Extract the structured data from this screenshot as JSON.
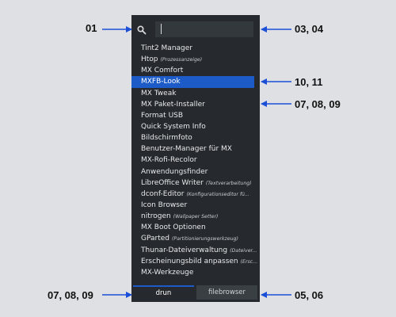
{
  "launcher": {
    "search": {
      "icon": "search-icon",
      "value": ""
    },
    "items": [
      {
        "label": "Tint2 Manager",
        "comment": ""
      },
      {
        "label": "Htop",
        "comment": "(Prozessanzeige)"
      },
      {
        "label": "MX Comfort",
        "comment": ""
      },
      {
        "label": "MXFB-Look",
        "comment": "",
        "selected": true
      },
      {
        "label": "MX Tweak",
        "comment": ""
      },
      {
        "label": "MX Paket-Installer",
        "comment": ""
      },
      {
        "label": "Format USB",
        "comment": ""
      },
      {
        "label": "Quick System Info",
        "comment": ""
      },
      {
        "label": "Bildschirmfoto",
        "comment": ""
      },
      {
        "label": "Benutzer-Manager für MX",
        "comment": ""
      },
      {
        "label": "MX-Rofi-Recolor",
        "comment": ""
      },
      {
        "label": "Anwendungsfinder",
        "comment": ""
      },
      {
        "label": "LibreOffice Writer",
        "comment": "(Textverarbeitung)"
      },
      {
        "label": "dconf-Editor",
        "comment": "(Konfigurationseditor fü..."
      },
      {
        "label": "Icon Browser",
        "comment": ""
      },
      {
        "label": "nitrogen",
        "comment": "(Wallpaper Setter)"
      },
      {
        "label": "MX Boot Optionen",
        "comment": ""
      },
      {
        "label": "GParted",
        "comment": "(Partitionierungswerkzeug)"
      },
      {
        "label": "Thunar-Dateiverwaltung",
        "comment": "(Dateiver..."
      },
      {
        "label": "Erscheinungsbild anpassen",
        "comment": "(Ersc..."
      },
      {
        "label": "MX-Werkzeuge",
        "comment": ""
      }
    ],
    "tabs": [
      {
        "label": "drun",
        "active": true
      },
      {
        "label": "filebrowser",
        "active": false
      }
    ]
  },
  "annotations": {
    "a01": "01",
    "a0304": "03, 04",
    "a1011": "10, 11",
    "a070809_right": "07, 08, 09",
    "a070809_left": "07, 08, 09",
    "a0506": "05, 06"
  },
  "colors": {
    "background": "#dfe0e3",
    "panel": "#262a2e",
    "selection": "#1d5cc8",
    "arrow": "#1b4fd8"
  }
}
